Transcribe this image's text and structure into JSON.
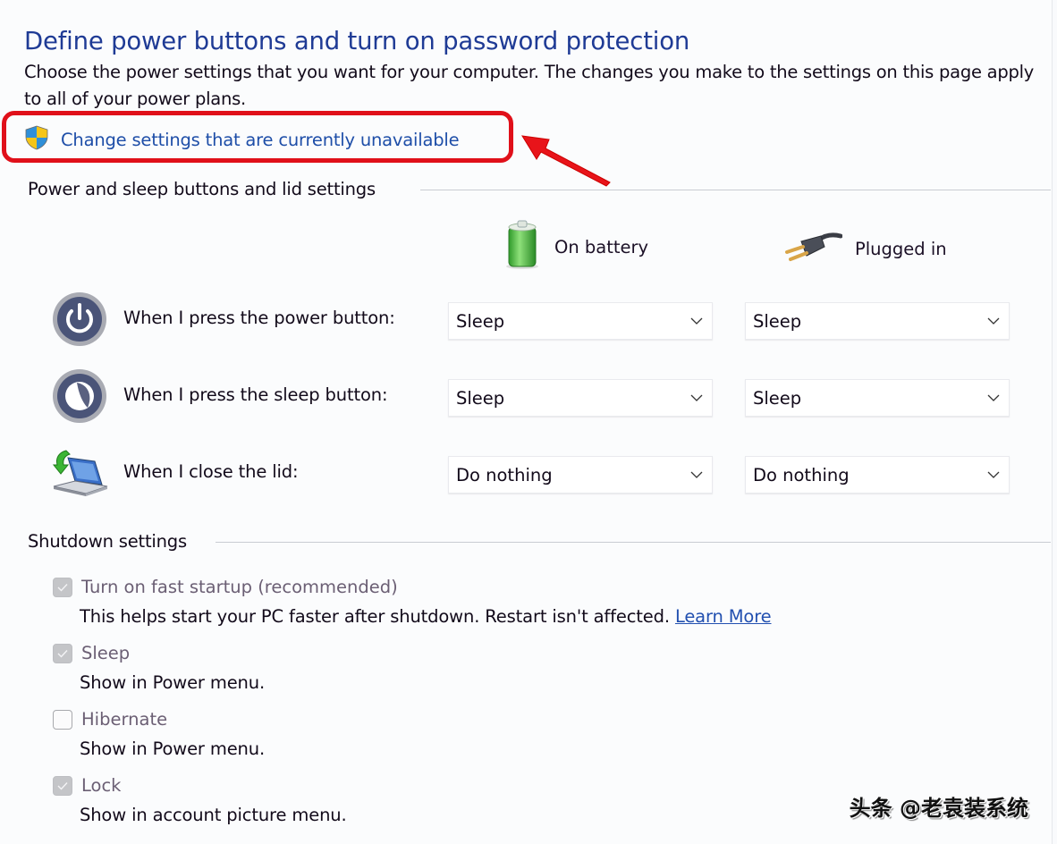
{
  "page": {
    "title": "Define power buttons and turn on password protection",
    "description": "Choose the power settings that you want for your computer. The changes you make to the settings on this page apply to all of your power plans.",
    "change_settings_link": "Change settings that are currently unavailable"
  },
  "annotation": {
    "highlight_color": "#e0101a"
  },
  "power_section": {
    "heading": "Power and sleep buttons and lid settings",
    "columns": [
      {
        "label": "On battery",
        "icon": "battery-icon"
      },
      {
        "label": "Plugged in",
        "icon": "power-plug-icon"
      }
    ],
    "rows": [
      {
        "label": "When I press the power button:",
        "icon": "power-button-icon",
        "on_battery": "Sleep",
        "plugged_in": "Sleep"
      },
      {
        "label": "When I press the sleep button:",
        "icon": "sleep-button-icon",
        "on_battery": "Sleep",
        "plugged_in": "Sleep"
      },
      {
        "label": "When I close the lid:",
        "icon": "laptop-lid-icon",
        "on_battery": "Do nothing",
        "plugged_in": "Do nothing"
      }
    ]
  },
  "shutdown_section": {
    "heading": "Shutdown settings",
    "items": [
      {
        "label": "Turn on fast startup (recommended)",
        "checked": true,
        "disabled": true,
        "description": "This helps start your PC faster after shutdown. Restart isn't affected.",
        "link": "Learn More"
      },
      {
        "label": "Sleep",
        "checked": true,
        "disabled": true,
        "description": "Show in Power menu."
      },
      {
        "label": "Hibernate",
        "checked": false,
        "disabled": true,
        "description": "Show in Power menu."
      },
      {
        "label": "Lock",
        "checked": true,
        "disabled": true,
        "description": "Show in account picture menu."
      }
    ]
  },
  "watermark": "头条 @老袁装系统"
}
